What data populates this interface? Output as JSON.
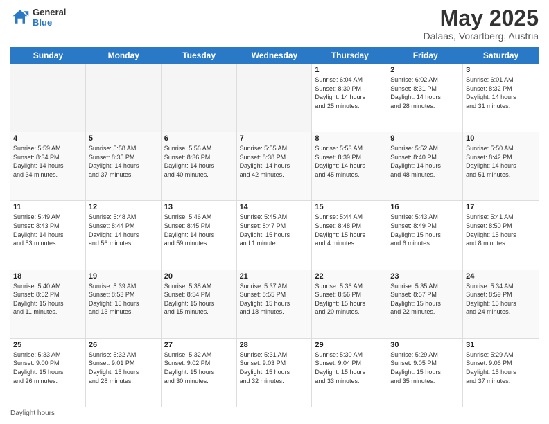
{
  "logo": {
    "line1": "General",
    "line2": "Blue"
  },
  "title": "May 2025",
  "location": "Dalaas, Vorarlberg, Austria",
  "weekdays": [
    "Sunday",
    "Monday",
    "Tuesday",
    "Wednesday",
    "Thursday",
    "Friday",
    "Saturday"
  ],
  "footer": "Daylight hours",
  "rows": [
    [
      {
        "day": "",
        "info": ""
      },
      {
        "day": "",
        "info": ""
      },
      {
        "day": "",
        "info": ""
      },
      {
        "day": "",
        "info": ""
      },
      {
        "day": "1",
        "info": "Sunrise: 6:04 AM\nSunset: 8:30 PM\nDaylight: 14 hours\nand 25 minutes."
      },
      {
        "day": "2",
        "info": "Sunrise: 6:02 AM\nSunset: 8:31 PM\nDaylight: 14 hours\nand 28 minutes."
      },
      {
        "day": "3",
        "info": "Sunrise: 6:01 AM\nSunset: 8:32 PM\nDaylight: 14 hours\nand 31 minutes."
      }
    ],
    [
      {
        "day": "4",
        "info": "Sunrise: 5:59 AM\nSunset: 8:34 PM\nDaylight: 14 hours\nand 34 minutes."
      },
      {
        "day": "5",
        "info": "Sunrise: 5:58 AM\nSunset: 8:35 PM\nDaylight: 14 hours\nand 37 minutes."
      },
      {
        "day": "6",
        "info": "Sunrise: 5:56 AM\nSunset: 8:36 PM\nDaylight: 14 hours\nand 40 minutes."
      },
      {
        "day": "7",
        "info": "Sunrise: 5:55 AM\nSunset: 8:38 PM\nDaylight: 14 hours\nand 42 minutes."
      },
      {
        "day": "8",
        "info": "Sunrise: 5:53 AM\nSunset: 8:39 PM\nDaylight: 14 hours\nand 45 minutes."
      },
      {
        "day": "9",
        "info": "Sunrise: 5:52 AM\nSunset: 8:40 PM\nDaylight: 14 hours\nand 48 minutes."
      },
      {
        "day": "10",
        "info": "Sunrise: 5:50 AM\nSunset: 8:42 PM\nDaylight: 14 hours\nand 51 minutes."
      }
    ],
    [
      {
        "day": "11",
        "info": "Sunrise: 5:49 AM\nSunset: 8:43 PM\nDaylight: 14 hours\nand 53 minutes."
      },
      {
        "day": "12",
        "info": "Sunrise: 5:48 AM\nSunset: 8:44 PM\nDaylight: 14 hours\nand 56 minutes."
      },
      {
        "day": "13",
        "info": "Sunrise: 5:46 AM\nSunset: 8:45 PM\nDaylight: 14 hours\nand 59 minutes."
      },
      {
        "day": "14",
        "info": "Sunrise: 5:45 AM\nSunset: 8:47 PM\nDaylight: 15 hours\nand 1 minute."
      },
      {
        "day": "15",
        "info": "Sunrise: 5:44 AM\nSunset: 8:48 PM\nDaylight: 15 hours\nand 4 minutes."
      },
      {
        "day": "16",
        "info": "Sunrise: 5:43 AM\nSunset: 8:49 PM\nDaylight: 15 hours\nand 6 minutes."
      },
      {
        "day": "17",
        "info": "Sunrise: 5:41 AM\nSunset: 8:50 PM\nDaylight: 15 hours\nand 8 minutes."
      }
    ],
    [
      {
        "day": "18",
        "info": "Sunrise: 5:40 AM\nSunset: 8:52 PM\nDaylight: 15 hours\nand 11 minutes."
      },
      {
        "day": "19",
        "info": "Sunrise: 5:39 AM\nSunset: 8:53 PM\nDaylight: 15 hours\nand 13 minutes."
      },
      {
        "day": "20",
        "info": "Sunrise: 5:38 AM\nSunset: 8:54 PM\nDaylight: 15 hours\nand 15 minutes."
      },
      {
        "day": "21",
        "info": "Sunrise: 5:37 AM\nSunset: 8:55 PM\nDaylight: 15 hours\nand 18 minutes."
      },
      {
        "day": "22",
        "info": "Sunrise: 5:36 AM\nSunset: 8:56 PM\nDaylight: 15 hours\nand 20 minutes."
      },
      {
        "day": "23",
        "info": "Sunrise: 5:35 AM\nSunset: 8:57 PM\nDaylight: 15 hours\nand 22 minutes."
      },
      {
        "day": "24",
        "info": "Sunrise: 5:34 AM\nSunset: 8:59 PM\nDaylight: 15 hours\nand 24 minutes."
      }
    ],
    [
      {
        "day": "25",
        "info": "Sunrise: 5:33 AM\nSunset: 9:00 PM\nDaylight: 15 hours\nand 26 minutes."
      },
      {
        "day": "26",
        "info": "Sunrise: 5:32 AM\nSunset: 9:01 PM\nDaylight: 15 hours\nand 28 minutes."
      },
      {
        "day": "27",
        "info": "Sunrise: 5:32 AM\nSunset: 9:02 PM\nDaylight: 15 hours\nand 30 minutes."
      },
      {
        "day": "28",
        "info": "Sunrise: 5:31 AM\nSunset: 9:03 PM\nDaylight: 15 hours\nand 32 minutes."
      },
      {
        "day": "29",
        "info": "Sunrise: 5:30 AM\nSunset: 9:04 PM\nDaylight: 15 hours\nand 33 minutes."
      },
      {
        "day": "30",
        "info": "Sunrise: 5:29 AM\nSunset: 9:05 PM\nDaylight: 15 hours\nand 35 minutes."
      },
      {
        "day": "31",
        "info": "Sunrise: 5:29 AM\nSunset: 9:06 PM\nDaylight: 15 hours\nand 37 minutes."
      }
    ]
  ]
}
